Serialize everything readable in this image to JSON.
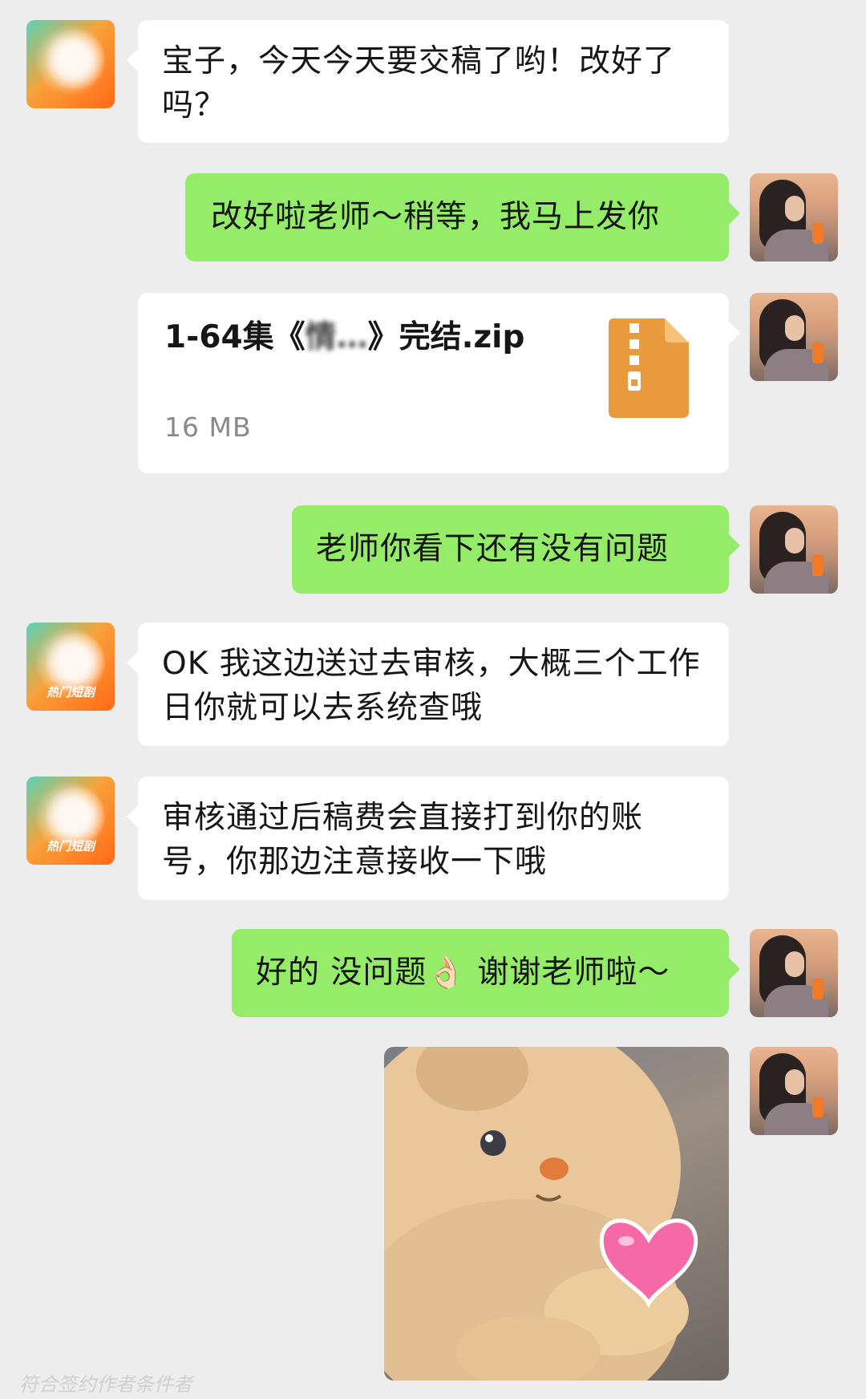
{
  "messages": [
    {
      "side": "left",
      "avatar": "brand",
      "text": "宝子，今天今天要交稿了哟！改好了吗？"
    },
    {
      "side": "right",
      "avatar": "user",
      "text": "改好啦老师～稍等，我马上发你"
    },
    {
      "side": "right",
      "avatar": "user",
      "type": "file",
      "file_name_prefix": "1-64集《",
      "file_name_blurred": "情…",
      "file_name_suffix": "》完结.zip",
      "file_size": "16 MB"
    },
    {
      "side": "right",
      "avatar": "user",
      "text": "老师你看下还有没有问题"
    },
    {
      "side": "left",
      "avatar": "brand",
      "avatar_tag": "热门短剧",
      "text": "OK 我这边送过去审核，大概三个工作日你就可以去系统查哦"
    },
    {
      "side": "left",
      "avatar": "brand",
      "avatar_tag": "热门短剧",
      "text": "审核通过后稿费会直接打到你的账号，你那边注意接收一下哦"
    },
    {
      "side": "right",
      "avatar": "user",
      "text": "好的 没问题👌🏻 谢谢老师啦～"
    },
    {
      "side": "right",
      "avatar": "user",
      "type": "sticker",
      "sticker": "bunny-heart"
    }
  ],
  "colors": {
    "background": "#ededed",
    "sent_bubble": "#95ec69",
    "received_bubble": "#ffffff",
    "zip_icon": "#e89a3c"
  },
  "watermark": "符合签约作者条件者"
}
